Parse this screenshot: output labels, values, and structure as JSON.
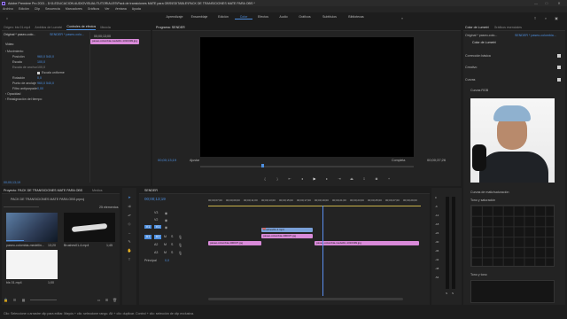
{
  "window": {
    "title": "Adobe Premiere Pro 2021 - D:\\5-EDUCACION AUDIOVISUAL\\TUTORIALES\\Pack de transiciones MATE para OBS\\EDITABLE\\PACK DE TRANSICIONES MATE PARA OBS *"
  },
  "menu": [
    "Archivo",
    "Edición",
    "Clip",
    "Secuencia",
    "Marcadores",
    "Gráficos",
    "Ver",
    "Ventana",
    "Ayuda"
  ],
  "workspaces": [
    "Aprendizaje",
    "Ensamblaje",
    "Edición",
    "Color",
    "Efectos",
    "Audio",
    "Gráficos",
    "Subtítulos",
    "Bibliotecas"
  ],
  "workspace_active": "Color",
  "source_tabs": [
    "Origen: bis 01.mp4",
    "Ámbitos de Lumetri",
    "Controles de efectos",
    "Mezcla"
  ],
  "effect_controls": {
    "master": "Original * paseo-colo...",
    "sequence": "SENDER * paseo-colo...",
    "video_label": "Vídeo",
    "clip_name": "paseo-colombia-medellin-1310499.jpg",
    "tc": "00;00;13;00",
    "rows": [
      {
        "label": "Movimiento",
        "value": ""
      },
      {
        "label": "Posición",
        "value": "960,0    540,0"
      },
      {
        "label": "Escala",
        "value": "100,0"
      },
      {
        "label": "Escala de anchura",
        "value": "100,0"
      },
      {
        "label": "Escala uniforme",
        "value": ""
      },
      {
        "label": "Rotación",
        "value": "0,0"
      },
      {
        "label": "Punto de anclaje",
        "value": "960,0    540,0"
      },
      {
        "label": "Filtro antiparpadeo",
        "value": "0,00"
      },
      {
        "label": "Opacidad",
        "value": ""
      },
      {
        "label": "Reasignación del tiempo",
        "value": ""
      }
    ],
    "bottom_tc": "00;00;13;19"
  },
  "program": {
    "tab": "Programa: SENDER",
    "tc_current": "00;00;13;19",
    "fit": "Ajustar",
    "quality": "Completa",
    "tc_duration": "00;00;37;26"
  },
  "project": {
    "tabs": [
      "Proyecto: PACK DE TRANSICIONES MATE PARA OBS",
      "Medios"
    ],
    "path": "PACK DE TRANSICIONES MATE PARA OBS.prproj",
    "count": "25 elementos",
    "items": [
      {
        "name": "paseo-colombia-medellin...",
        "duration": "13;20"
      },
      {
        "name": "Brushes01-4.mp4",
        "duration": "1;45"
      },
      {
        "name": "bis 01.mp4",
        "duration": "1;00"
      }
    ]
  },
  "timeline": {
    "tab": "SENDER",
    "tc": "00;00;13;19",
    "ruler": [
      "00;00;07;00",
      "00;00;09;00",
      "00;00;11;00",
      "00;00;13;00",
      "00;00;15;00",
      "00;00;17;00",
      "00;00;19;00",
      "00;00;21;00",
      "00;00;23;00",
      "00;00;25;00",
      "00;00;27;00",
      "00;00;29;00"
    ],
    "video_tracks": [
      "V3",
      "V2",
      "V1"
    ],
    "audio_tracks": [
      "A1",
      "A2",
      "A3"
    ],
    "master": "Principal",
    "master_val": "0,0",
    "clips": [
      {
        "name": "Brushes01-4.mp4",
        "track": "v3"
      },
      {
        "name": "paseo-colombia-400037.jpg",
        "track": "v2"
      },
      {
        "name": "paseo-colombia-400037.jpg",
        "track": "v1a"
      },
      {
        "name": "paseo-colombia-medellin-1310499.jpg",
        "track": "v1b"
      }
    ]
  },
  "lumetri": {
    "tabs": [
      "Color de Lumetri",
      "Gráficos esenciales"
    ],
    "master": "Original * paseo-colo...",
    "sequence": "SENDER * paseo-colombia...",
    "title": "Color de Lumetri",
    "sections": [
      "Corrección básica",
      "Creativo",
      "Curvas"
    ],
    "rgb_label": "Curvas RGB",
    "hue_sat": "Curvas de matiz/saturación",
    "hue_vs_sat": "Tono y saturación",
    "hue_vs_hue": "Tono y tono"
  },
  "meter": {
    "labels": [
      "0",
      "-6",
      "-12",
      "-18",
      "-24",
      "-30",
      "-36",
      "-42",
      "-48",
      "-54"
    ],
    "s_labels": [
      "S",
      "S"
    ]
  },
  "statusbar": "Clic: Seleccione o arrastre clip para editar. Mayús + clic: seleccione rango. Alt + clic: duplicar. Control + clic: selección de clip exclusiva.",
  "colors": {
    "accent": "#4d8fe0",
    "clip_pink": "#d98ad9",
    "clip_blue": "#7aa0d8",
    "clip_red": "#c86b6b",
    "playhead": "#5b8ff0"
  }
}
